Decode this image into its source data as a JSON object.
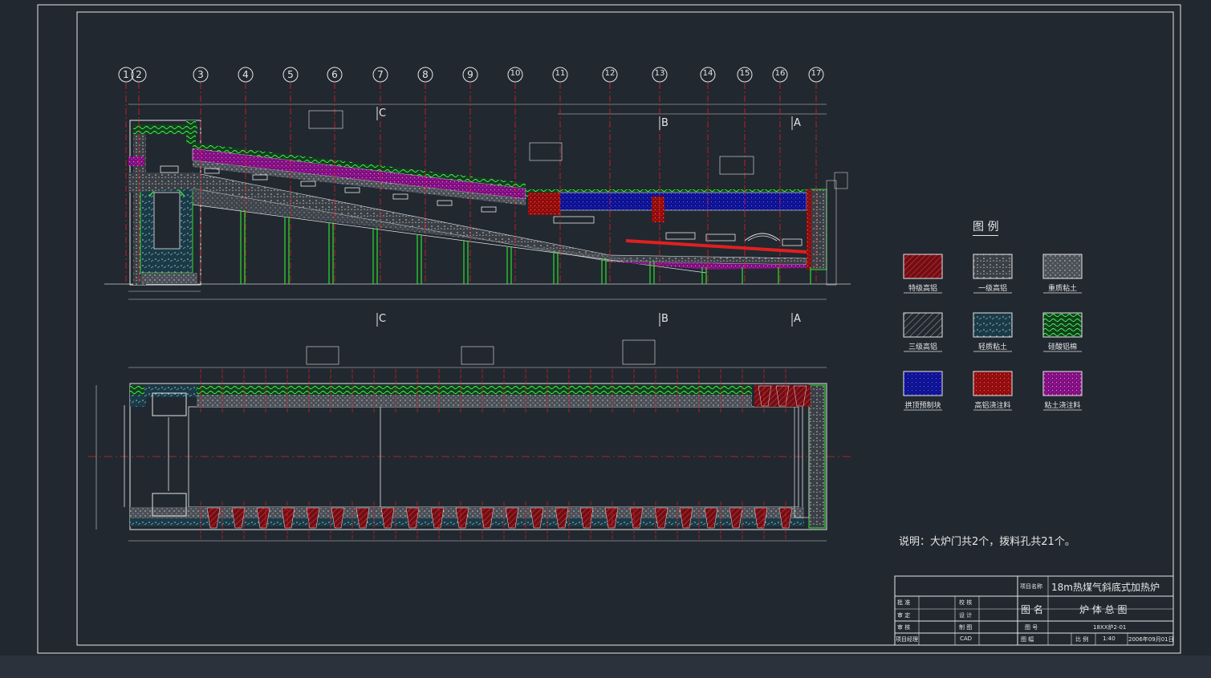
{
  "grid_axes": [
    "1",
    "2",
    "3",
    "4",
    "5",
    "6",
    "7",
    "8",
    "9",
    "10",
    "11",
    "12",
    "13",
    "14",
    "15",
    "16",
    "17"
  ],
  "section_marks": [
    "C",
    "B",
    "A"
  ],
  "legend": {
    "title": "图 例",
    "items": [
      {
        "label": "特级高铝",
        "color": "#a81c28",
        "pattern": "hatch"
      },
      {
        "label": "一级高铝",
        "color": "#4a4f55",
        "pattern": "speckle"
      },
      {
        "label": "重质粘土",
        "color": "#3d4148",
        "pattern": "speckle"
      },
      {
        "label": "三级高铝",
        "color": "#3a3e44",
        "pattern": "hatch"
      },
      {
        "label": "轻质粘土",
        "color": "#1f3b4a",
        "pattern": "speckle"
      },
      {
        "label": "硅酸铝棉",
        "color": "#1b5e2a",
        "pattern": "wave"
      },
      {
        "label": "拱顶预制块",
        "color": "#12158f",
        "pattern": "dots"
      },
      {
        "label": "高铝浇注料",
        "color": "#b01515",
        "pattern": "dots"
      },
      {
        "label": "粘土浇注料",
        "color": "#b01cb0",
        "pattern": "dots"
      }
    ]
  },
  "note": "说明：大炉门共2个，拨料孔共21个。",
  "title_block": {
    "project_label": "项目名称",
    "project_name": "18m热煤气斜底式加热炉",
    "drawing_name_label": "图 名",
    "drawing_name": "炉 体 总 图",
    "approve": "批 准",
    "check": "校 核",
    "review": "审 定",
    "design": "设 计",
    "audit": "审 核",
    "draw": "制 图",
    "drawing_no_label": "图 号",
    "drawing_no": "18XX炉2-01",
    "project_lead": "项目经理",
    "cad": "CAD",
    "sheet": "图 幅",
    "scale_label": "比 例",
    "scale": "1:40",
    "date": "2006年09月01日"
  },
  "colors": {
    "background": "#212830",
    "line": "#e6e6e6",
    "red": "#e02020",
    "green": "#2ee02e",
    "magenta": "#c020c0",
    "blue": "#1818a0"
  }
}
